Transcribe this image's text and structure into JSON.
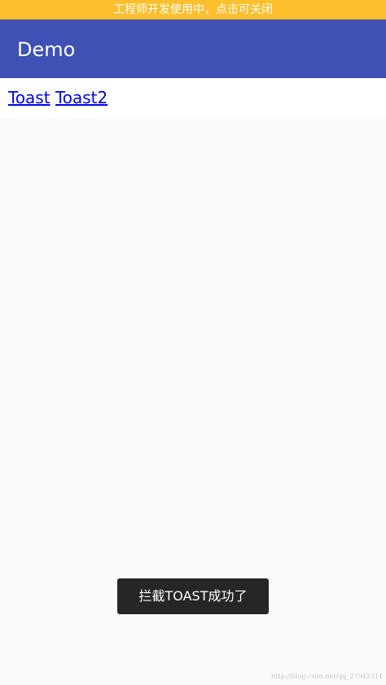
{
  "dev_banner": {
    "text": "工程师开发使用中，点击可关闭"
  },
  "app_bar": {
    "title": "Demo"
  },
  "links": {
    "toast_label": "Toast",
    "toast2_label": "Toast2"
  },
  "toast": {
    "message": "拦截TOAST成功了"
  },
  "watermark": {
    "text": "http://blog.csdn.net/qq_27942311"
  },
  "colors": {
    "dev_banner": "#fdbf2d",
    "app_bar": "#3f51b5",
    "link": "#0000ee",
    "toast_bg": "#262626",
    "page_bg": "#fafafa"
  }
}
